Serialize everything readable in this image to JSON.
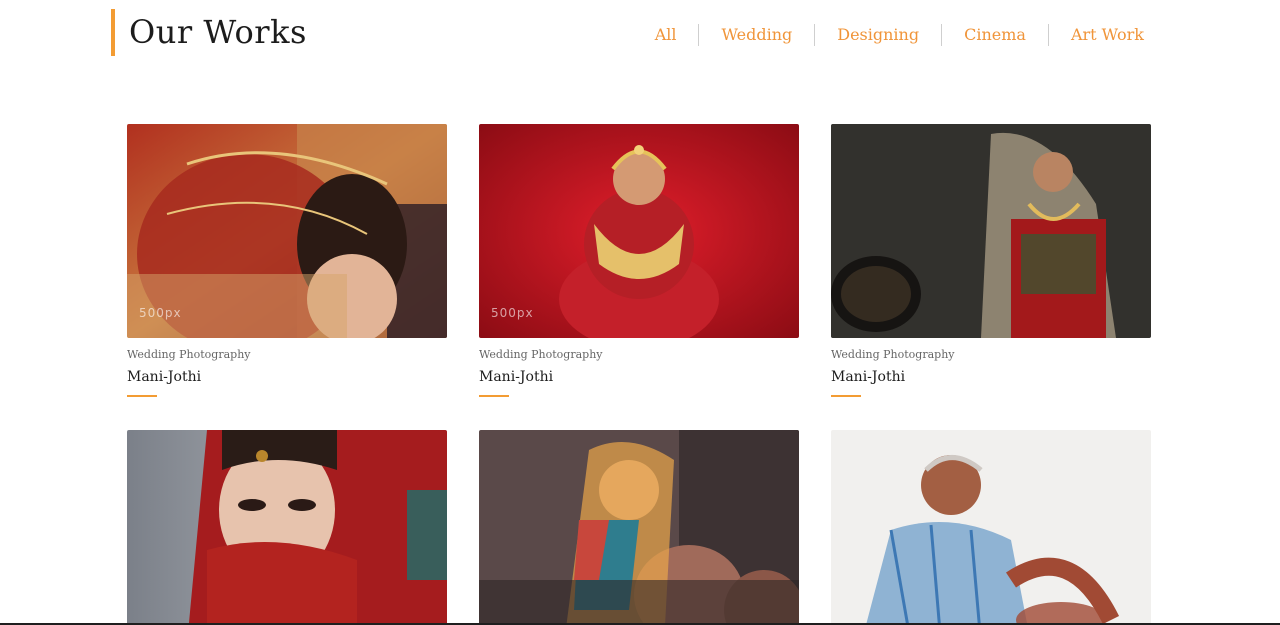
{
  "header": {
    "title": "Our Works",
    "accent_color": "#f39c33"
  },
  "filters": [
    {
      "label": "All"
    },
    {
      "label": "Wedding"
    },
    {
      "label": "Designing"
    },
    {
      "label": "Cinema"
    },
    {
      "label": "Art Work"
    }
  ],
  "works": [
    {
      "category": "Wedding Photography",
      "title": "Mani-Jothi",
      "watermark": "500px"
    },
    {
      "category": "Wedding Photography",
      "title": "Mani-Jothi",
      "watermark": "500px"
    },
    {
      "category": "Wedding Photography",
      "title": "Mani-Jothi"
    },
    {},
    {},
    {}
  ]
}
